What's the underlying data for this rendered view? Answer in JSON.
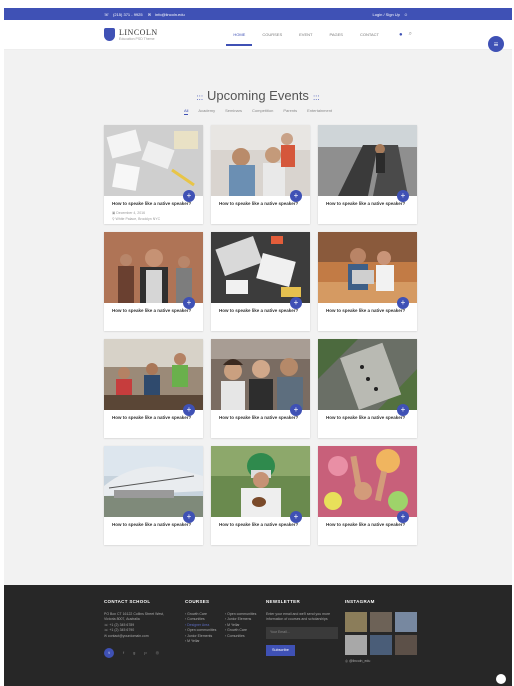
{
  "topbar": {
    "phone": "(215) 371 - 9925",
    "email": "info@lincoln.edu",
    "login": "Login / Sign Up"
  },
  "header": {
    "logo_title": "LINCOLN",
    "logo_subtitle": "Education PSD Theme",
    "nav": [
      "HOME",
      "COURSES",
      "EVENT",
      "PAGES",
      "CONTACT"
    ],
    "nav_active": "HOME"
  },
  "section": {
    "title": "Upcoming Events",
    "filters": [
      "All",
      "Academy",
      "Seminars",
      "Competition",
      "Parents",
      "Entertainment"
    ],
    "active_filter": "All"
  },
  "events": [
    {
      "title": "How to speake like a native speaker?",
      "date": "December 4, 2016",
      "location": "White Palace, Brooklyn NYC"
    },
    {
      "title": "How to speake like a native speaker?"
    },
    {
      "title": "How to speake like a native speaker?"
    },
    {
      "title": "How to speake like a native speaker?"
    },
    {
      "title": "How to speake like a native speaker?"
    },
    {
      "title": "How to speake like a native speaker?"
    },
    {
      "title": "How to speake like a native speaker?"
    },
    {
      "title": "How to speake like a native speaker?"
    },
    {
      "title": "How to speake like a native speaker?"
    },
    {
      "title": "How to speake like a native speaker?"
    },
    {
      "title": "How to speake like a native speaker?"
    },
    {
      "title": "How to speake like a native speaker?"
    }
  ],
  "footer": {
    "contact_heading": "CONTACT SCHOOL",
    "address": "PO Box CT 16122 Collins Street West, Victoria 8007, Australia",
    "phone1": "+1 (2) 345 6789",
    "phone2": "+1 (2) 345 6790",
    "email": "contact@yourdomain.com",
    "courses_heading": "COURSES",
    "courses_col1": [
      "Growth Care",
      "Comunities",
      "Designer Area",
      "Open communities",
      "Junior Elements",
      "M Yellar"
    ],
    "courses_col2": [
      "Open communities",
      "Junior Elemens",
      "M Yellar",
      "Growth Care",
      "Comunities"
    ],
    "newsletter_heading": "NEWSLETTER",
    "newsletter_text": "Enter your email and we'll send you more information of courses and scholarships",
    "email_placeholder": "Your Email...",
    "subscribe_label": "Subscribe",
    "instagram_heading": "INSTAGRAM",
    "instagram_handle": "@lincoln_edu"
  },
  "colors": {
    "accent": "#3f51b5",
    "footer_bg": "#272727",
    "page_bg": "#f2f2f2"
  }
}
